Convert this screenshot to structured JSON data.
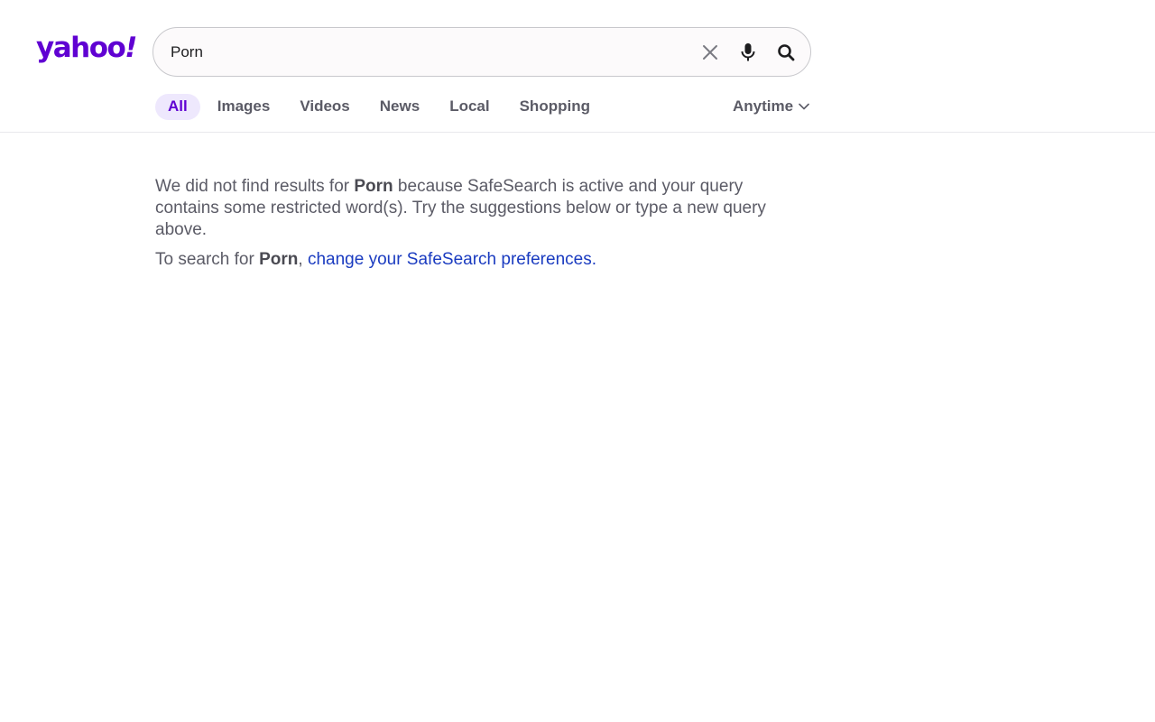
{
  "brand": {
    "logo_text": "yahoo",
    "logo_bang": "!"
  },
  "search": {
    "value": "Porn",
    "placeholder": ""
  },
  "icons": {
    "clear": "close-icon",
    "mic": "microphone-icon",
    "search": "search-icon",
    "dropdown": "chevron-down-icon"
  },
  "tabs": [
    {
      "label": "All",
      "active": true
    },
    {
      "label": "Images"
    },
    {
      "label": "Videos"
    },
    {
      "label": "News"
    },
    {
      "label": "Local"
    },
    {
      "label": "Shopping"
    }
  ],
  "time_filter": {
    "label": "Anytime"
  },
  "message": {
    "p1_before": "We did not find results for ",
    "query": "Porn",
    "p1_after": " because SafeSearch is active and your query contains some restricted word(s). Try the suggestions below or type a new query above.",
    "p2_before": "To search for ",
    "p2_comma": ", ",
    "link": "change your SafeSearch preferences."
  },
  "colors": {
    "brand": "#6001d2",
    "link": "#1a3bc0",
    "active_tab_bg": "#eee8fd"
  }
}
